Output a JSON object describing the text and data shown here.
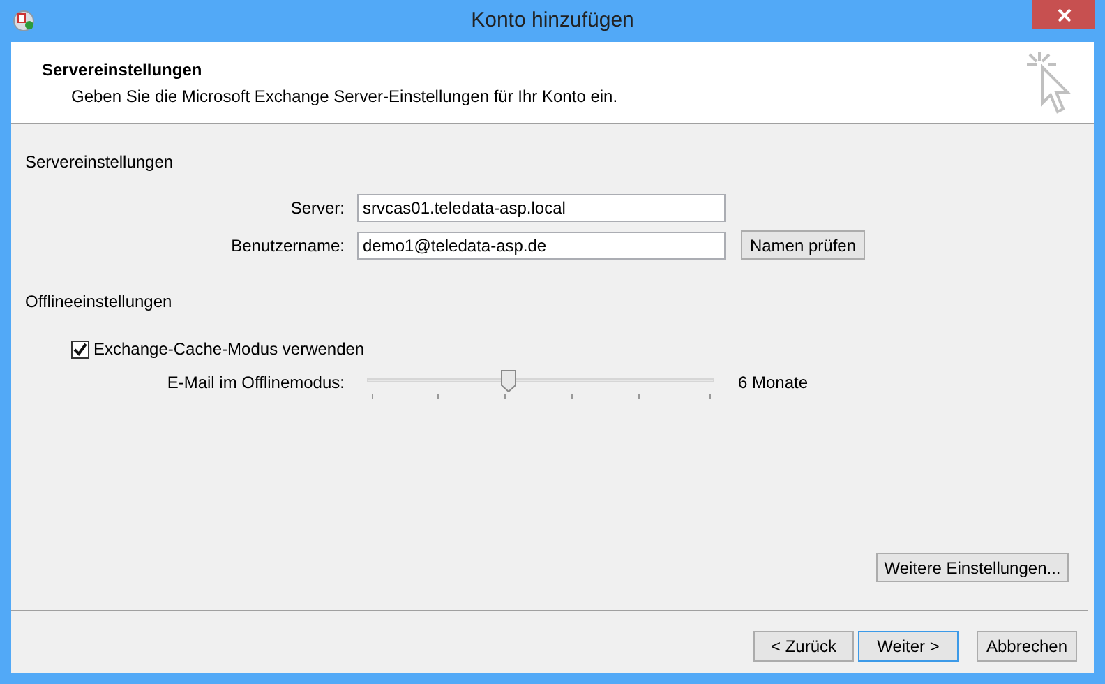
{
  "window": {
    "title": "Konto hinzufügen"
  },
  "header": {
    "title": "Servereinstellungen",
    "subtitle": "Geben Sie die Microsoft Exchange Server-Einstellungen für Ihr Konto ein."
  },
  "server_section": {
    "heading": "Servereinstellungen",
    "server_label": "Server:",
    "server_value": "srvcas01.teledata-asp.local",
    "user_label": "Benutzername:",
    "user_value": "demo1@teledata-asp.de",
    "check_button": "Namen prüfen"
  },
  "offline_section": {
    "heading": "Offlineeinstellungen",
    "cache_mode": {
      "label": "Exchange-Cache-Modus verwenden",
      "checked": true
    },
    "slider": {
      "label": "E-Mail im Offlinemodus:",
      "level": 0.4,
      "reading": "6 Monate"
    }
  },
  "more_button": "Weitere Einstellungen...",
  "buttons": [
    {
      "label": "< Zurück",
      "focused": false
    },
    {
      "label": "Weiter >",
      "focused": true
    },
    {
      "label": "Abbrechen",
      "focused": false
    }
  ]
}
